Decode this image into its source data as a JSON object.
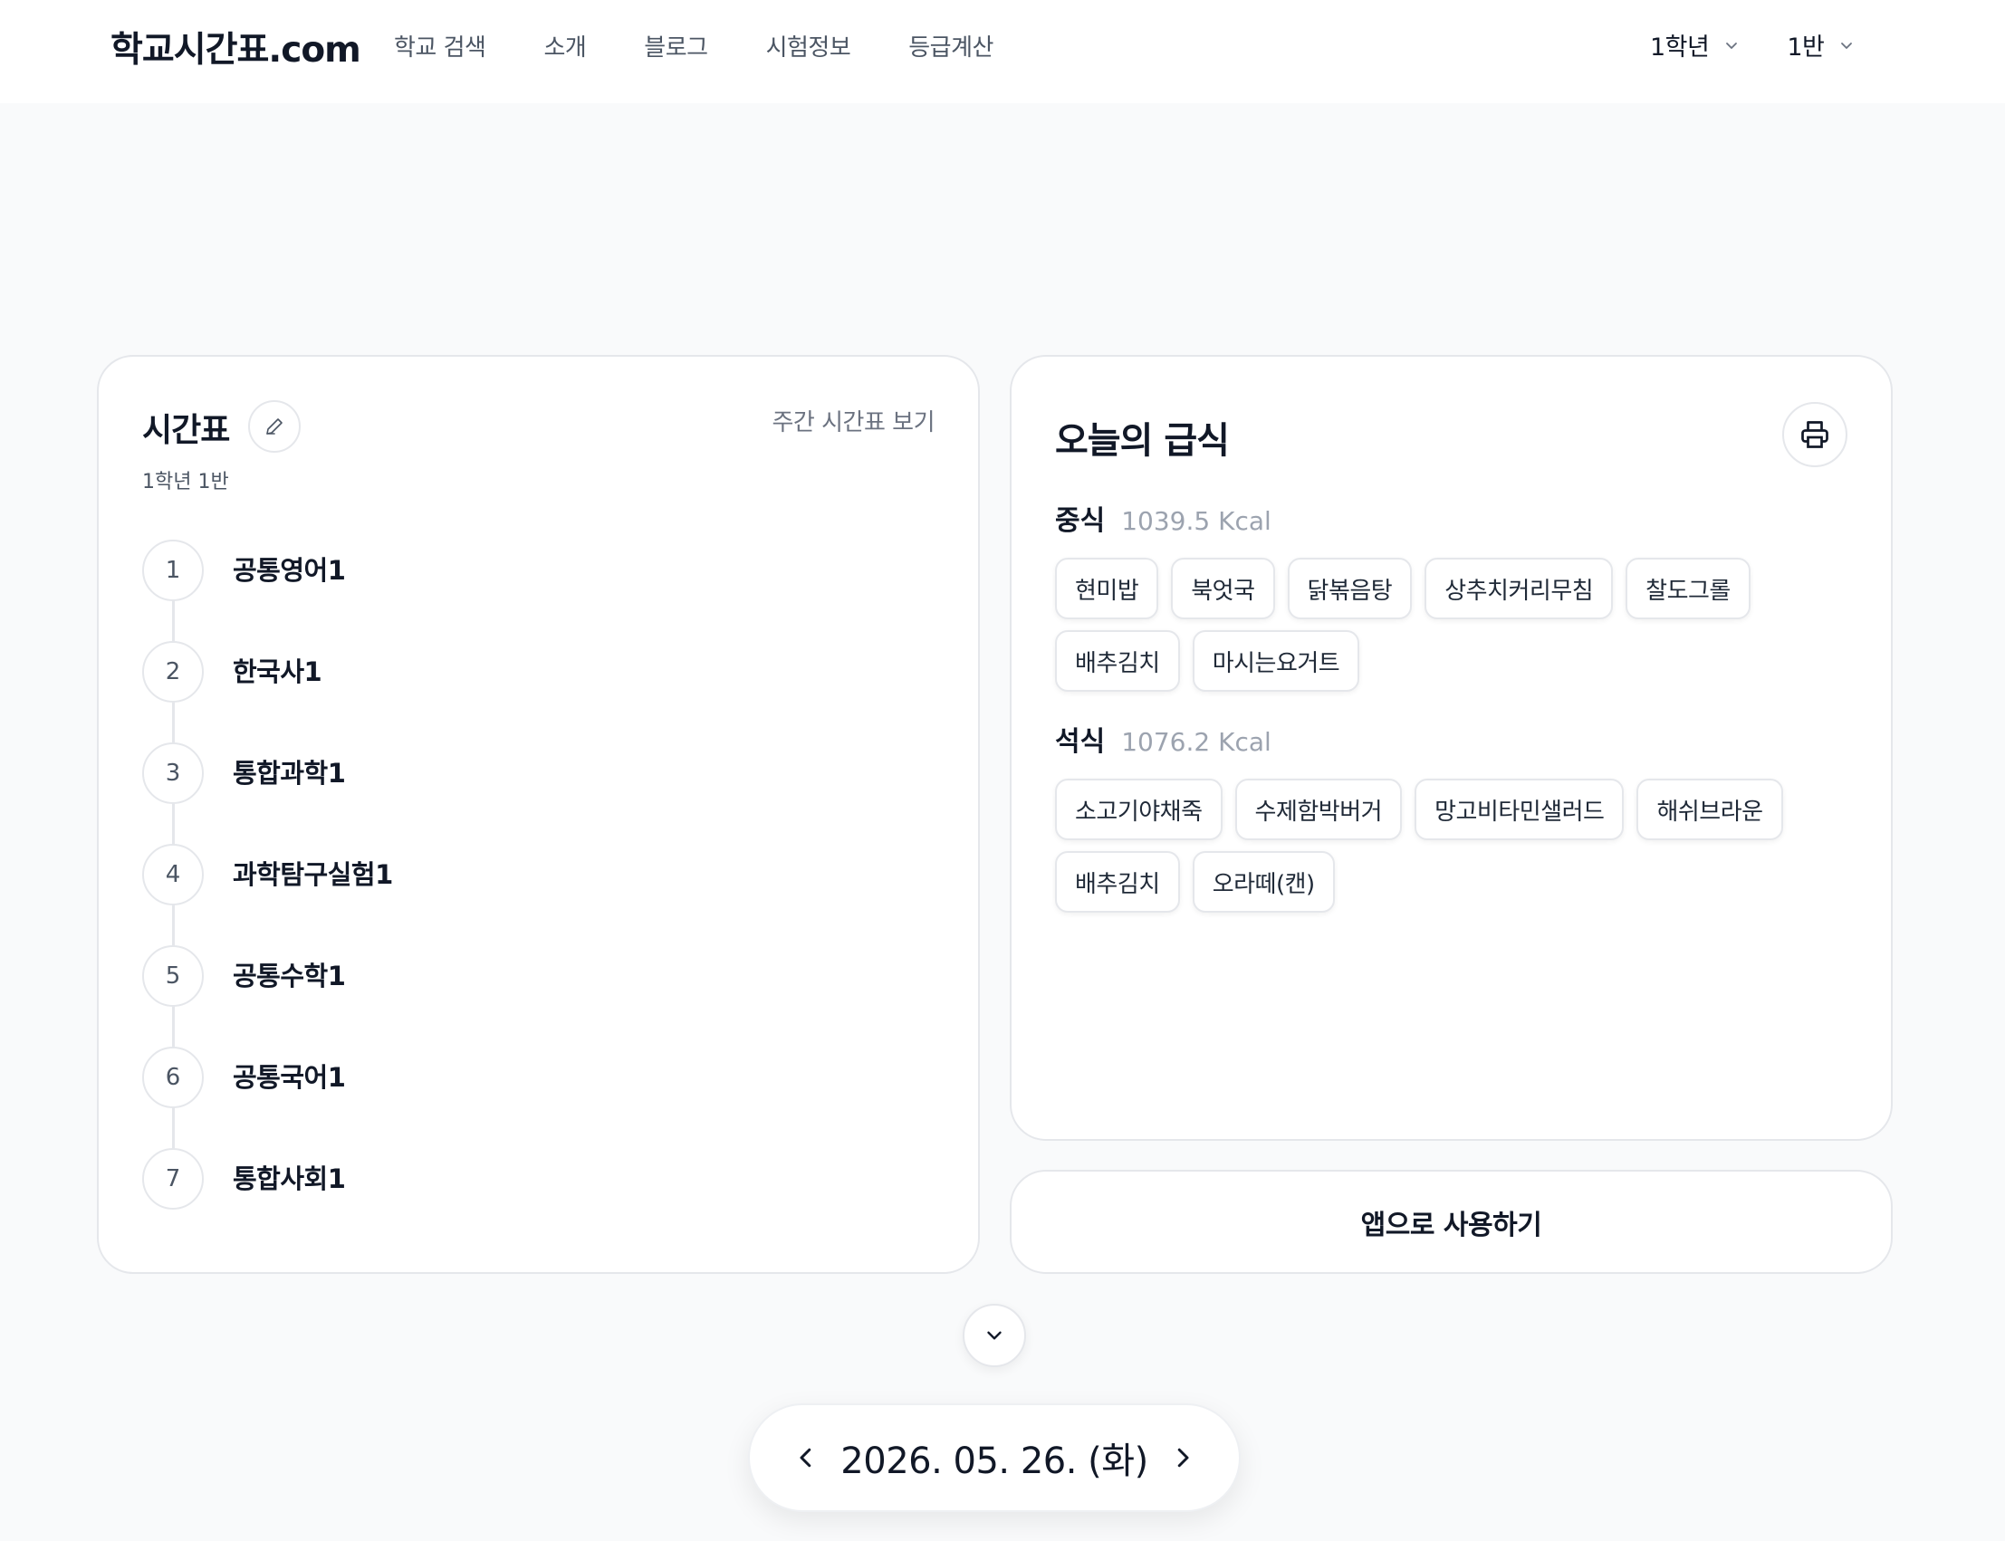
{
  "header": {
    "logo": "학교시간표.com",
    "nav": [
      {
        "label": "학교 검색"
      },
      {
        "label": "소개"
      },
      {
        "label": "블로그"
      },
      {
        "label": "시험정보"
      },
      {
        "label": "등급계산"
      }
    ],
    "grade_select": "1학년",
    "class_select": "1반"
  },
  "timetable": {
    "title": "시간표",
    "subtitle": "1학년 1반",
    "weekly_link": "주간 시간표 보기",
    "periods": [
      {
        "num": "1",
        "subject": "공통영어1"
      },
      {
        "num": "2",
        "subject": "한국사1"
      },
      {
        "num": "3",
        "subject": "통합과학1"
      },
      {
        "num": "4",
        "subject": "과학탐구실험1"
      },
      {
        "num": "5",
        "subject": "공통수학1"
      },
      {
        "num": "6",
        "subject": "공통국어1"
      },
      {
        "num": "7",
        "subject": "통합사회1"
      }
    ]
  },
  "meal": {
    "title": "오늘의 급식",
    "lunch": {
      "name": "중식",
      "kcal": "1039.5 Kcal",
      "dishes": [
        "현미밥",
        "북엇국",
        "닭볶음탕",
        "상추치커리무침",
        "찰도그롤",
        "배추김치",
        "마시는요거트"
      ]
    },
    "dinner": {
      "name": "석식",
      "kcal": "1076.2 Kcal",
      "dishes": [
        "소고기야채죽",
        "수제함박버거",
        "망고비타민샐러드",
        "해쉬브라운",
        "배추김치",
        "오라떼(캔)"
      ]
    }
  },
  "app_button": "앱으로 사용하기",
  "date_nav": {
    "date": "2026. 05. 26. (화)"
  },
  "icons": {
    "edit": "pencil-icon",
    "print": "printer-icon",
    "expand": "chevron-down-icon",
    "prev": "chevron-left-icon",
    "next": "chevron-right-icon"
  }
}
